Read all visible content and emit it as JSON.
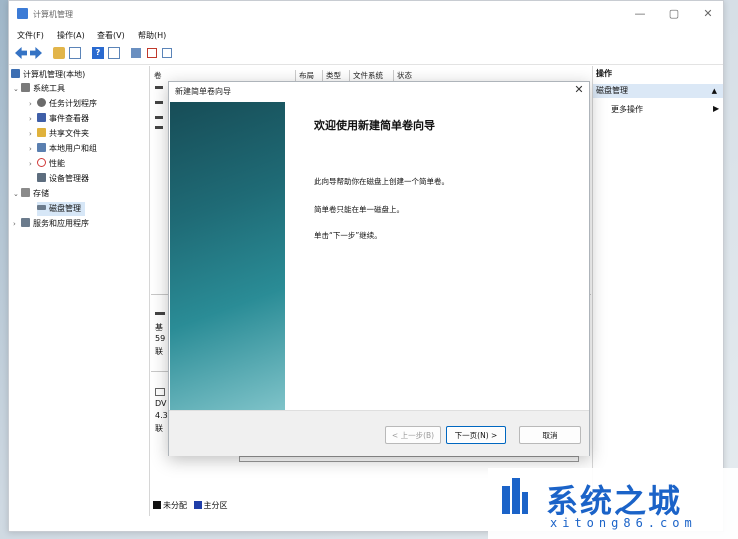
{
  "window": {
    "title": "计算机管理",
    "controls": [
      "—",
      "▢",
      "✕"
    ]
  },
  "menu": [
    "文件(F)",
    "操作(A)",
    "查看(V)",
    "帮助(H)"
  ],
  "tree": [
    {
      "label": "计算机管理(本地)",
      "icon": "computer-icon",
      "color": "#3d6fb3"
    },
    {
      "label": "系统工具",
      "icon": "tools-icon",
      "color": "#7a7a7a"
    },
    {
      "label": "任务计划程序",
      "icon": "clock-icon",
      "color": "#6b6b6b"
    },
    {
      "label": "事件查看器",
      "icon": "event-viewer-icon",
      "color": "#3f5fa8"
    },
    {
      "label": "共享文件夹",
      "icon": "shared-folder-icon",
      "color": "#e0b23c"
    },
    {
      "label": "本地用户和组",
      "icon": "users-icon",
      "color": "#5a7fb0"
    },
    {
      "label": "性能",
      "icon": "performance-icon",
      "color": "#d03a3a"
    },
    {
      "label": "设备管理器",
      "icon": "device-manager-icon",
      "color": "#5d6d7e"
    },
    {
      "label": "存储",
      "icon": "storage-icon",
      "color": "#8a8a8a"
    },
    {
      "label": "磁盘管理",
      "icon": "disk-icon",
      "color": "#6b7b8c"
    },
    {
      "label": "服务和应用程序",
      "icon": "services-icon",
      "color": "#6b7b8c"
    }
  ],
  "center": {
    "columns": [
      "卷",
      "布局",
      "类型",
      "文件系统",
      "状态"
    ],
    "disk_fragments": [
      "基",
      "59",
      "联",
      "DV",
      "4.3",
      "联"
    ],
    "legend": [
      {
        "label": "未分配",
        "color": "#111111"
      },
      {
        "label": "主分区",
        "color": "#1f3ea8"
      }
    ]
  },
  "actions": {
    "header": "操作",
    "section": "磁盘管理",
    "more": "更多操作"
  },
  "dialog": {
    "title": "新建简单卷向导",
    "heading": "欢迎使用新建简单卷向导",
    "lines": [
      "此向导帮助你在磁盘上创建一个简单卷。",
      "简单卷只能在单一磁盘上。",
      "单击“下一步”继续。"
    ],
    "buttons": {
      "back": "< 上一步(B)",
      "next": "下一页(N) >",
      "cancel": "取消"
    }
  },
  "watermark": {
    "title": "系统之城",
    "url": "xitong86.com"
  }
}
